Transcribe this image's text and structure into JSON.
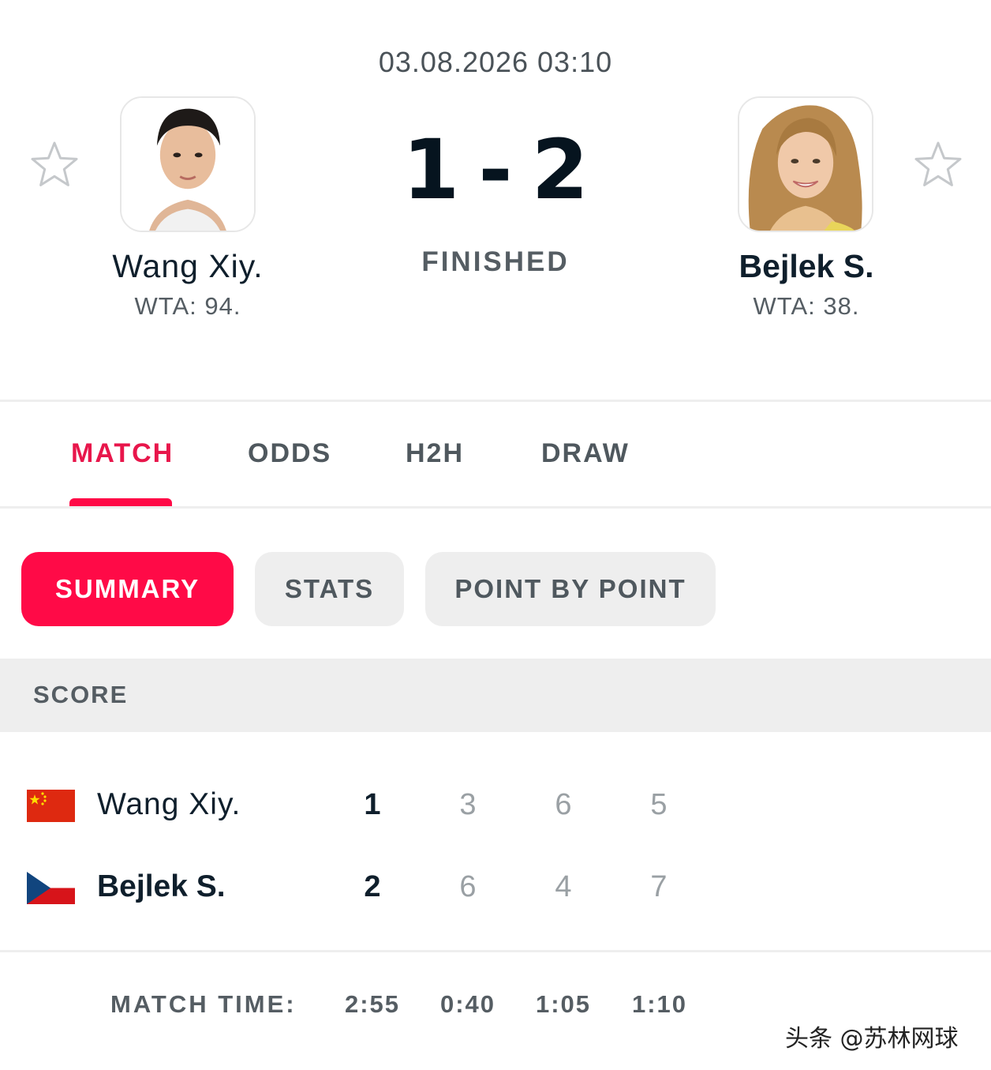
{
  "match": {
    "datetime": "03.08.2026 03:10",
    "score_home": "1",
    "score_separator": "-",
    "score_away": "2",
    "status": "FINISHED"
  },
  "home": {
    "name": "Wang Xiy.",
    "rank": "WTA: 94."
  },
  "away": {
    "name": "Bejlek S.",
    "rank": "WTA: 38."
  },
  "tabs": [
    {
      "label": "MATCH",
      "active": true
    },
    {
      "label": "ODDS",
      "active": false
    },
    {
      "label": "H2H",
      "active": false
    },
    {
      "label": "DRAW",
      "active": false
    }
  ],
  "subtabs": [
    {
      "label": "SUMMARY",
      "active": true
    },
    {
      "label": "STATS",
      "active": false
    },
    {
      "label": "POINT BY POINT",
      "active": false
    }
  ],
  "score_table": {
    "header": "SCORE",
    "rows": [
      {
        "name": "Wang Xiy.",
        "flag": "china-flag",
        "sets_won": "1",
        "sets": [
          "3",
          "6",
          "5"
        ]
      },
      {
        "name": "Bejlek S.",
        "flag": "czech-flag",
        "sets_won": "2",
        "sets": [
          "6",
          "4",
          "7"
        ]
      }
    ]
  },
  "match_time": {
    "label": "MATCH TIME:",
    "total": "2:55",
    "sets": [
      "0:40",
      "1:05",
      "1:10"
    ]
  },
  "watermark": "头条 @苏林网球",
  "colors": {
    "accent": "#ff0a47",
    "accent_text": "#e8164b",
    "pill_bg": "#eeeeee",
    "section_bg": "#eeeeee"
  },
  "icons": {
    "favorite": "star-outline-icon"
  }
}
